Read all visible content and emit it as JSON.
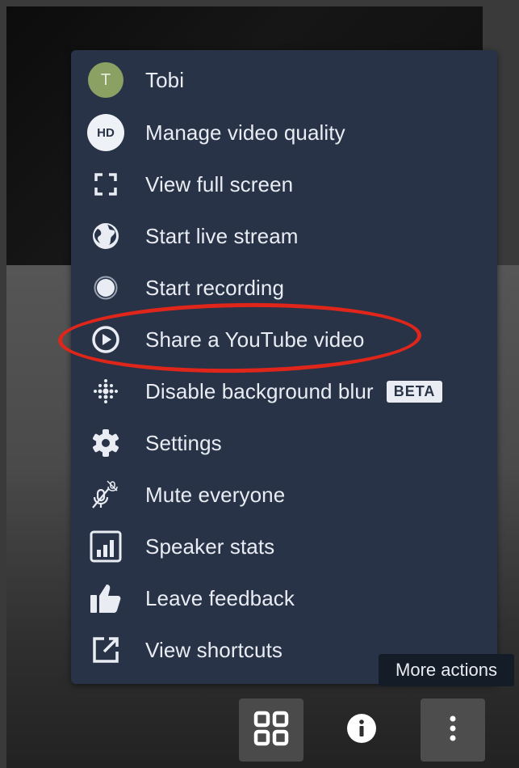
{
  "menu": {
    "items": [
      {
        "label": "Tobi",
        "icon": "avatar",
        "avatar_initial": "T"
      },
      {
        "label": "Manage video quality",
        "icon": "hd-icon",
        "icon_text": "HD"
      },
      {
        "label": "View full screen",
        "icon": "fullscreen-icon"
      },
      {
        "label": "Start live stream",
        "icon": "globe-icon"
      },
      {
        "label": "Start recording",
        "icon": "record-icon"
      },
      {
        "label": "Share a YouTube video",
        "icon": "play-circle-icon"
      },
      {
        "label": "Disable background blur",
        "icon": "blur-icon",
        "badge": "BETA"
      },
      {
        "label": "Settings",
        "icon": "gear-icon"
      },
      {
        "label": "Mute everyone",
        "icon": "mic-muted-icon"
      },
      {
        "label": "Speaker stats",
        "icon": "bar-chart-icon"
      },
      {
        "label": "Leave feedback",
        "icon": "thumbs-up-icon"
      },
      {
        "label": "View shortcuts",
        "icon": "external-link-icon"
      }
    ]
  },
  "tooltip": {
    "text": "More actions"
  },
  "toolbar": {
    "buttons": [
      {
        "name": "tile-view",
        "icon": "grid-icon"
      },
      {
        "name": "info",
        "icon": "info-icon"
      },
      {
        "name": "more-actions",
        "icon": "more-vertical-icon"
      }
    ]
  },
  "colors": {
    "menu_bg": "#283347",
    "highlight": "#e0261a",
    "text": "#e9edf3",
    "avatar": "#8aa163"
  }
}
